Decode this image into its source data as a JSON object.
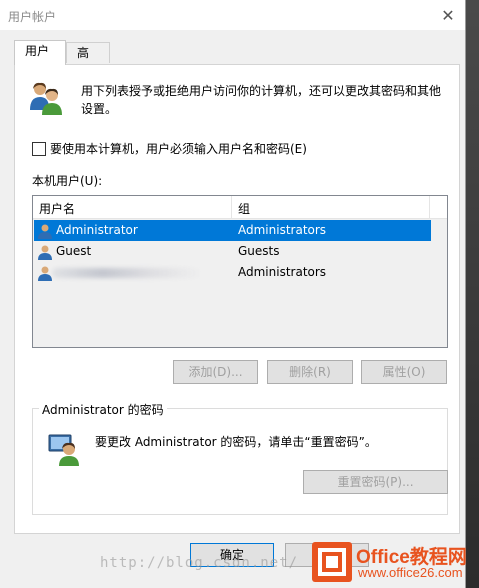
{
  "window": {
    "title": "用户帐户",
    "close": "✕"
  },
  "tabs": [
    {
      "label": "用户"
    },
    {
      "label": "高级"
    }
  ],
  "description": "用下列表授予或拒绝用户访问你的计算机，还可以更改其密码和其他设置。",
  "require_login_checkbox": {
    "label": "要使用本计算机，用户必须输入用户名和密码(E)",
    "checked": false
  },
  "local_users_label": "本机用户(U):",
  "users_table": {
    "columns": [
      "用户名",
      "组"
    ],
    "rows": [
      {
        "name": "Administrator",
        "group": "Administrators",
        "selected": true
      },
      {
        "name": "Guest",
        "group": "Guests",
        "selected": false
      },
      {
        "name": "",
        "group": "Administrators",
        "selected": false,
        "name_obscured": true
      }
    ]
  },
  "buttons": {
    "add": "添加(D)...",
    "remove": "删除(R)",
    "properties": "属性(O)"
  },
  "password_group": {
    "title": "Administrator 的密码",
    "text": "要更改 Administrator 的密码，请单击“重置密码”。",
    "reset_button": "重置密码(P)..."
  },
  "footer": {
    "ok": "确定"
  },
  "watermark": "http://blog.csdn.net/",
  "logo": {
    "title": "Office教程网",
    "url": "www.office26.com"
  },
  "colors": {
    "selection": "#0078d7",
    "logo": "#e8531f"
  }
}
